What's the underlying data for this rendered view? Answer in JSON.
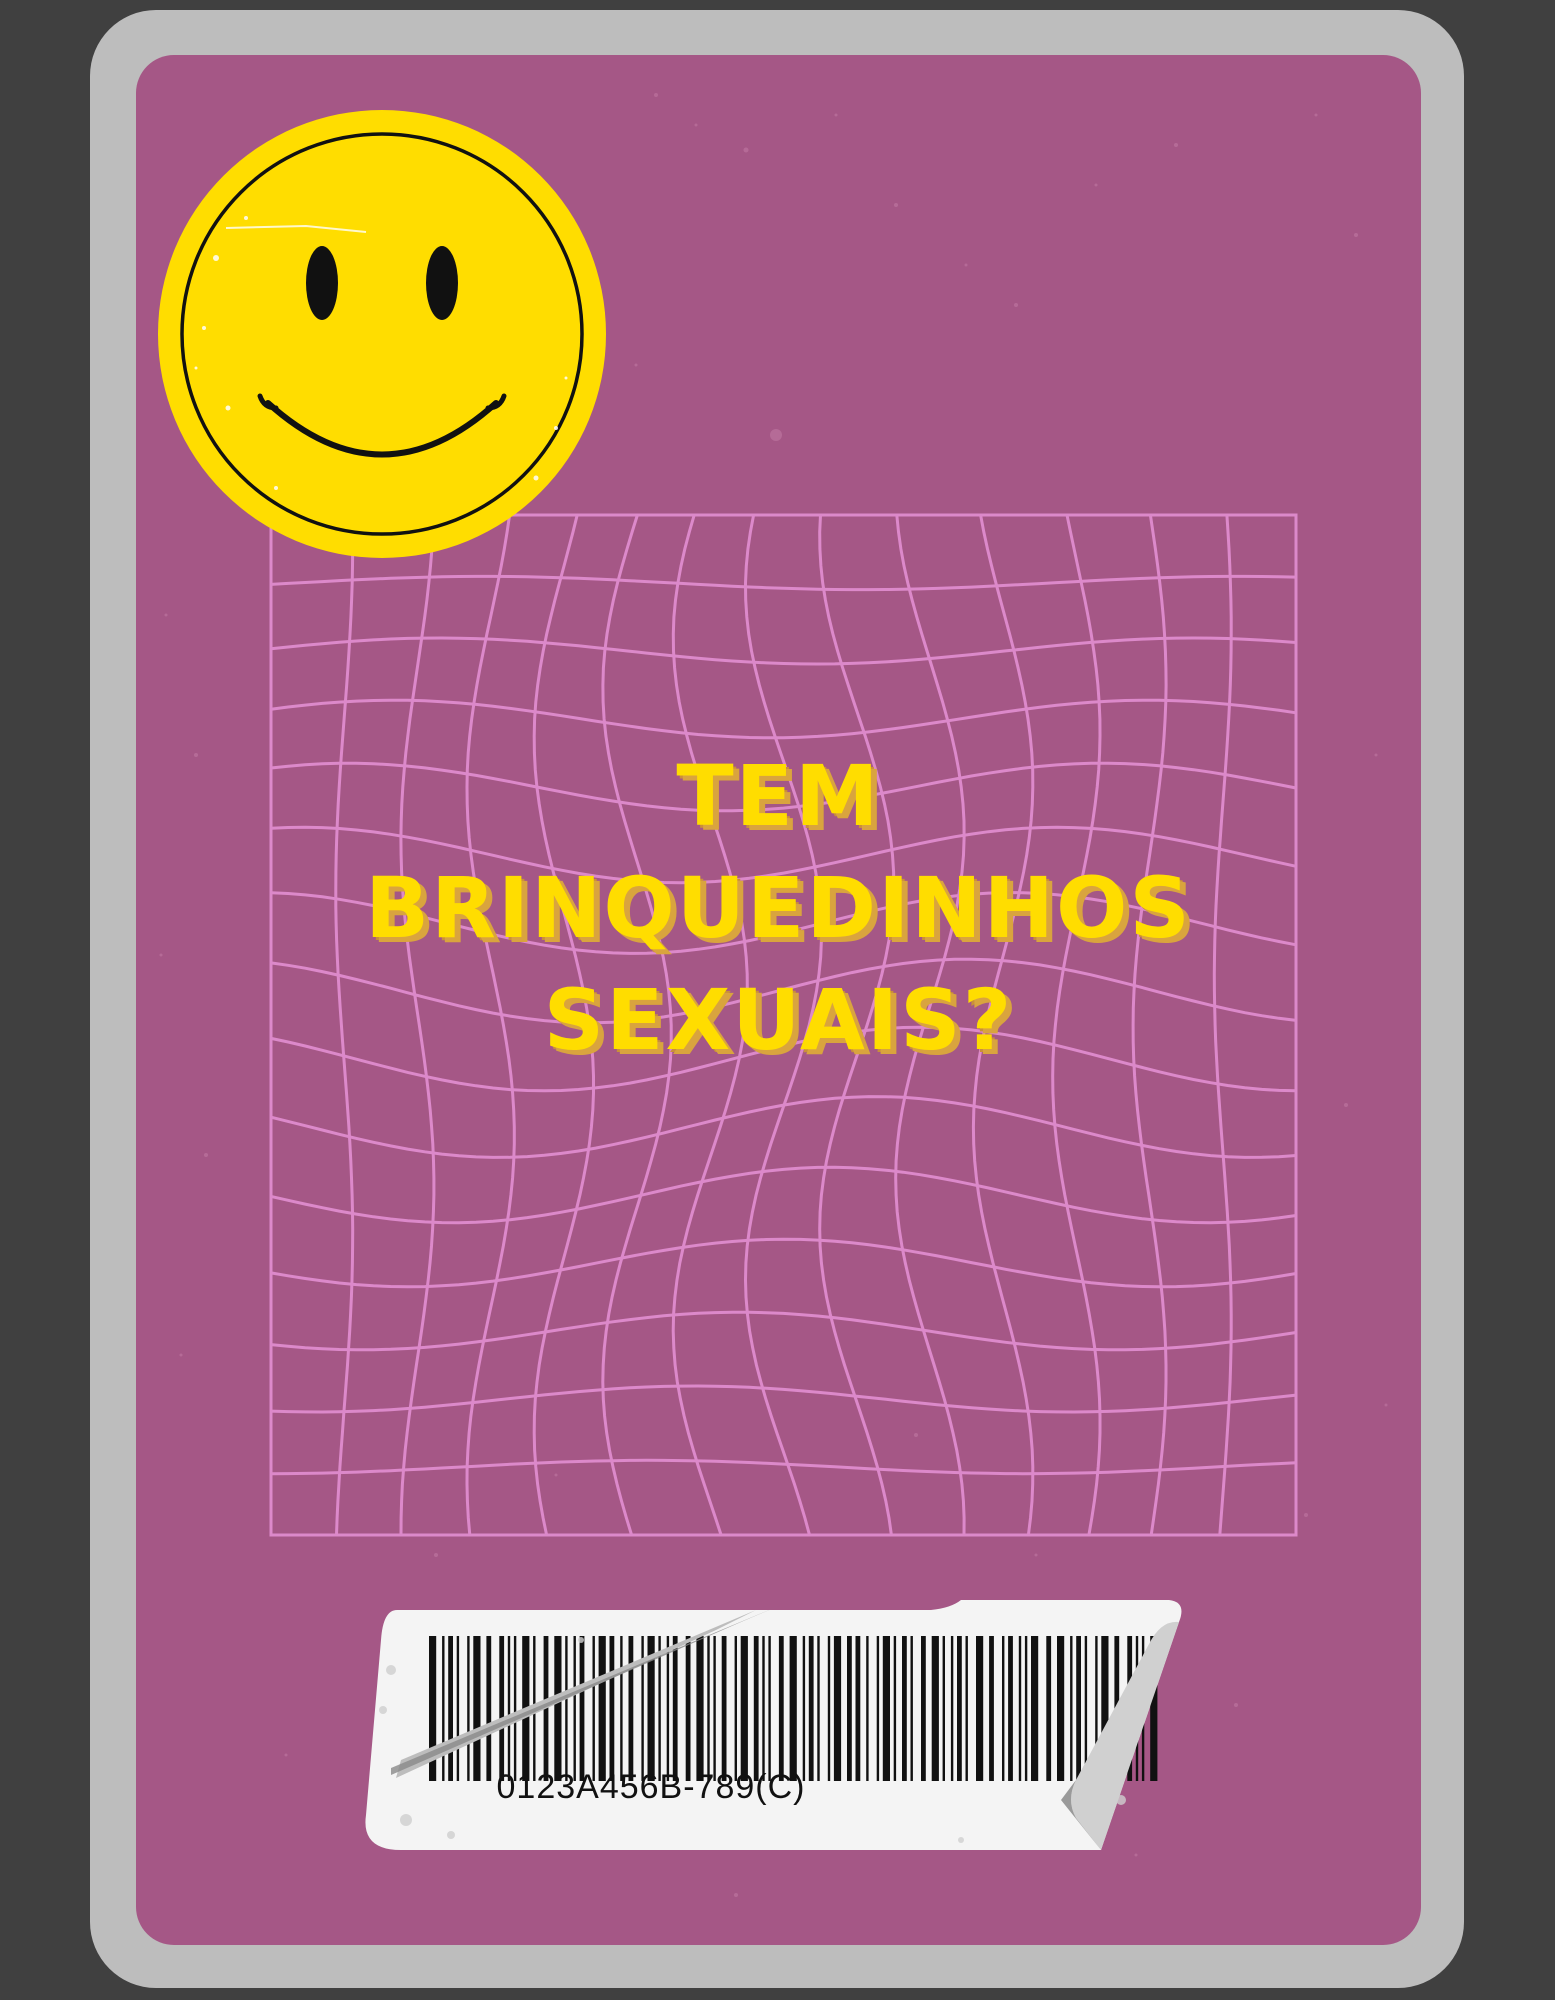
{
  "card": {
    "title_lines": [
      "TEM",
      "BRINQUEDINHOS",
      "SEXUAIS?"
    ],
    "barcode_number": "0123A456B-789(C)"
  },
  "icons": {
    "smiley": "smiley-face-icon",
    "barcode": "barcode-icon"
  },
  "colors": {
    "background": "#404040",
    "frame": "#bdbdbd",
    "card": "#a55786",
    "grid": "#e38fd2",
    "title": "#ffdd00",
    "smiley": "#ffdd00"
  }
}
